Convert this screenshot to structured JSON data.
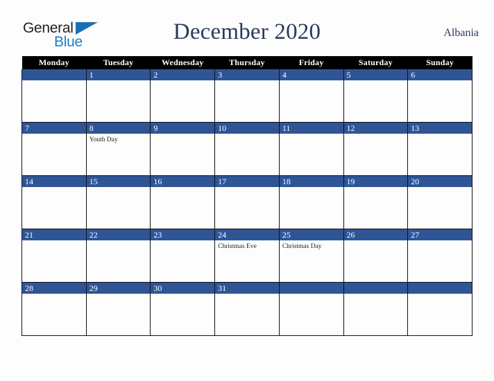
{
  "brand": {
    "word_one": "General",
    "word_two": "Blue",
    "triangle_icon": "triangle-icon",
    "color_dark": "#231f20",
    "color_blue": "#1b7fc4"
  },
  "header": {
    "title": "December 2020",
    "country": "Albania",
    "title_color": "#2b3a5c"
  },
  "calendar": {
    "weekday_headers": [
      "Monday",
      "Tuesday",
      "Wednesday",
      "Thursday",
      "Friday",
      "Saturday",
      "Sunday"
    ],
    "header_bg": "#000000",
    "daynum_bg": "#2f5597",
    "cell_bg": "#fdfdfd",
    "weeks": [
      [
        {
          "day": "",
          "event": ""
        },
        {
          "day": "1",
          "event": ""
        },
        {
          "day": "2",
          "event": ""
        },
        {
          "day": "3",
          "event": ""
        },
        {
          "day": "4",
          "event": ""
        },
        {
          "day": "5",
          "event": ""
        },
        {
          "day": "6",
          "event": ""
        }
      ],
      [
        {
          "day": "7",
          "event": ""
        },
        {
          "day": "8",
          "event": "Youth Day"
        },
        {
          "day": "9",
          "event": ""
        },
        {
          "day": "10",
          "event": ""
        },
        {
          "day": "11",
          "event": ""
        },
        {
          "day": "12",
          "event": ""
        },
        {
          "day": "13",
          "event": ""
        }
      ],
      [
        {
          "day": "14",
          "event": ""
        },
        {
          "day": "15",
          "event": ""
        },
        {
          "day": "16",
          "event": ""
        },
        {
          "day": "17",
          "event": ""
        },
        {
          "day": "18",
          "event": ""
        },
        {
          "day": "19",
          "event": ""
        },
        {
          "day": "20",
          "event": ""
        }
      ],
      [
        {
          "day": "21",
          "event": ""
        },
        {
          "day": "22",
          "event": ""
        },
        {
          "day": "23",
          "event": ""
        },
        {
          "day": "24",
          "event": "Christmas Eve"
        },
        {
          "day": "25",
          "event": "Christmas Day"
        },
        {
          "day": "26",
          "event": ""
        },
        {
          "day": "27",
          "event": ""
        }
      ],
      [
        {
          "day": "28",
          "event": ""
        },
        {
          "day": "29",
          "event": ""
        },
        {
          "day": "30",
          "event": ""
        },
        {
          "day": "31",
          "event": ""
        },
        {
          "day": "",
          "event": ""
        },
        {
          "day": "",
          "event": ""
        },
        {
          "day": "",
          "event": ""
        }
      ]
    ]
  }
}
